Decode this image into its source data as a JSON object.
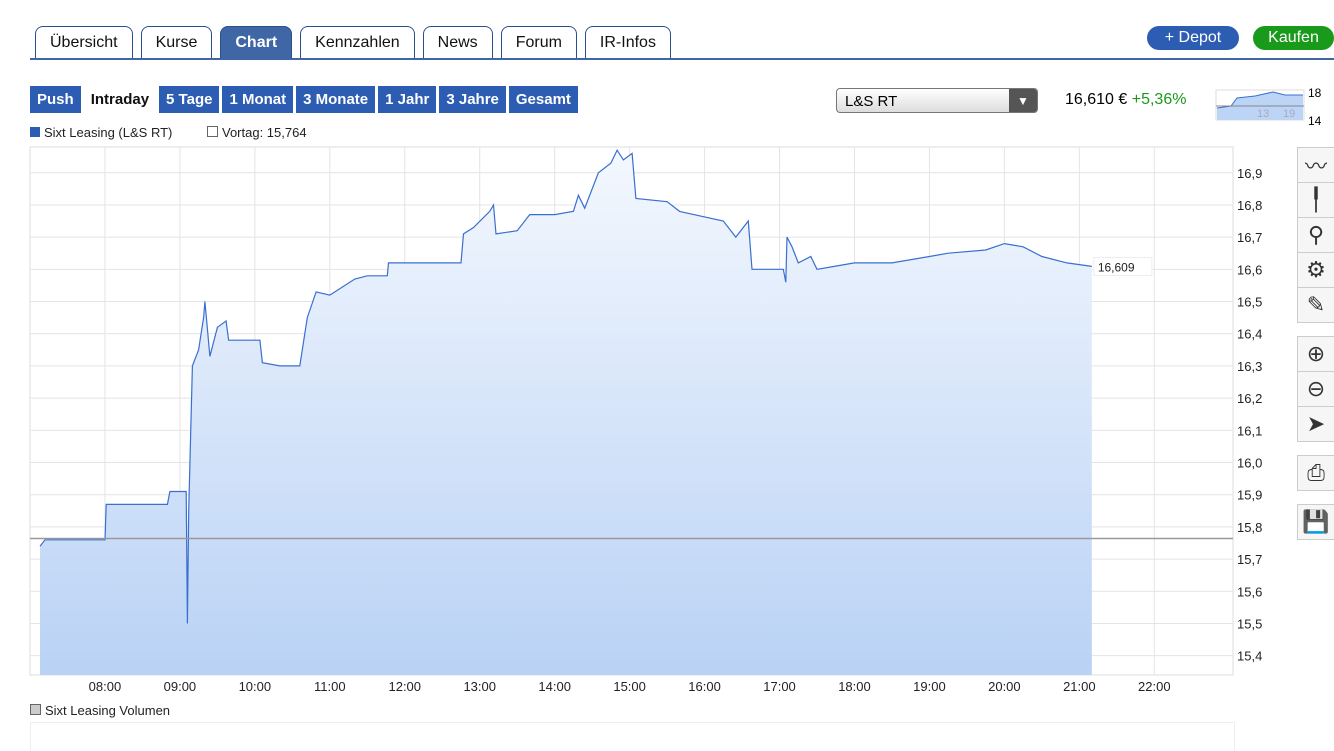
{
  "tabs": [
    "Übersicht",
    "Kurse",
    "Chart",
    "Kennzahlen",
    "News",
    "Forum",
    "IR-Infos"
  ],
  "active_tab": "Chart",
  "buttons": {
    "depot": "+ Depot",
    "kaufen": "Kaufen"
  },
  "ranges": [
    "Push",
    "Intraday",
    "5 Tage",
    "1 Monat",
    "3 Monate",
    "1 Jahr",
    "3 Jahre",
    "Gesamt"
  ],
  "active_range": "Intraday",
  "exchange_select": "L&S RT",
  "quote": {
    "price": "16,610 €",
    "change": "+5,36%"
  },
  "mini_chart": {
    "y_top": "18",
    "y_bottom": "14",
    "x_labels": [
      "13",
      "19"
    ]
  },
  "legend": {
    "series": "Sixt Leasing (L&S RT)",
    "previous": "Vortag: 15,764",
    "volume": "Sixt Leasing Volumen"
  },
  "colors": {
    "accent": "#2d5db3",
    "positive": "#1a9a1a",
    "line": "#3a6fd0"
  },
  "tools": [
    "line-chart-icon",
    "ohlc-chart-icon",
    "indicator-icon",
    "settings-icon",
    "draw-icon",
    "zoom-in-icon",
    "zoom-out-icon",
    "pointer-icon",
    "print-icon",
    "save-icon"
  ],
  "chart_data": {
    "type": "area",
    "last_label": "16,609",
    "previous_close": 15.764,
    "xlim": [
      "07:00",
      "23:03"
    ],
    "ylim": [
      15.34,
      16.98
    ],
    "x_ticks": [
      "08:00",
      "09:00",
      "10:00",
      "11:00",
      "12:00",
      "13:00",
      "14:00",
      "15:00",
      "16:00",
      "17:00",
      "18:00",
      "19:00",
      "20:00",
      "21:00",
      "22:00"
    ],
    "y_ticks": [
      "15,4",
      "15,5",
      "15,6",
      "15,7",
      "15,8",
      "15,9",
      "16,0",
      "16,1",
      "16,2",
      "16,3",
      "16,4",
      "16,5",
      "16,6",
      "16,7",
      "16,8",
      "16,9"
    ],
    "points": [
      [
        "07:08",
        15.74
      ],
      [
        "07:12",
        15.76
      ],
      [
        "08:00",
        15.76
      ],
      [
        "08:01",
        15.87
      ],
      [
        "08:50",
        15.87
      ],
      [
        "08:52",
        15.91
      ],
      [
        "09:05",
        15.91
      ],
      [
        "09:06",
        15.5
      ],
      [
        "09:07",
        15.85
      ],
      [
        "09:10",
        16.3
      ],
      [
        "09:15",
        16.35
      ],
      [
        "09:19",
        16.45
      ],
      [
        "09:20",
        16.5
      ],
      [
        "09:24",
        16.33
      ],
      [
        "09:30",
        16.42
      ],
      [
        "09:37",
        16.44
      ],
      [
        "09:39",
        16.38
      ],
      [
        "10:04",
        16.38
      ],
      [
        "10:06",
        16.31
      ],
      [
        "10:20",
        16.3
      ],
      [
        "10:36",
        16.3
      ],
      [
        "10:42",
        16.45
      ],
      [
        "10:49",
        16.53
      ],
      [
        "11:00",
        16.52
      ],
      [
        "11:20",
        16.57
      ],
      [
        "11:30",
        16.58
      ],
      [
        "11:46",
        16.58
      ],
      [
        "11:47",
        16.62
      ],
      [
        "12:45",
        16.62
      ],
      [
        "12:47",
        16.71
      ],
      [
        "12:55",
        16.73
      ],
      [
        "13:08",
        16.78
      ],
      [
        "13:11",
        16.8
      ],
      [
        "13:13",
        16.71
      ],
      [
        "13:30",
        16.72
      ],
      [
        "13:40",
        16.77
      ],
      [
        "14:00",
        16.77
      ],
      [
        "14:15",
        16.78
      ],
      [
        "14:19",
        16.83
      ],
      [
        "14:24",
        16.79
      ],
      [
        "14:35",
        16.9
      ],
      [
        "14:45",
        16.93
      ],
      [
        "14:50",
        16.97
      ],
      [
        "14:55",
        16.94
      ],
      [
        "15:02",
        16.96
      ],
      [
        "15:05",
        16.82
      ],
      [
        "15:30",
        16.81
      ],
      [
        "15:40",
        16.78
      ],
      [
        "16:15",
        16.75
      ],
      [
        "16:25",
        16.7
      ],
      [
        "16:35",
        16.75
      ],
      [
        "16:38",
        16.6
      ],
      [
        "17:03",
        16.6
      ],
      [
        "17:05",
        16.56
      ],
      [
        "17:06",
        16.7
      ],
      [
        "17:10",
        16.67
      ],
      [
        "17:15",
        16.62
      ],
      [
        "17:25",
        16.64
      ],
      [
        "17:30",
        16.6
      ],
      [
        "17:45",
        16.61
      ],
      [
        "18:00",
        16.62
      ],
      [
        "18:30",
        16.62
      ],
      [
        "19:00",
        16.64
      ],
      [
        "19:15",
        16.65
      ],
      [
        "19:45",
        16.66
      ],
      [
        "20:00",
        16.68
      ],
      [
        "20:15",
        16.67
      ],
      [
        "20:30",
        16.64
      ],
      [
        "20:50",
        16.62
      ],
      [
        "21:10",
        16.609
      ]
    ]
  }
}
